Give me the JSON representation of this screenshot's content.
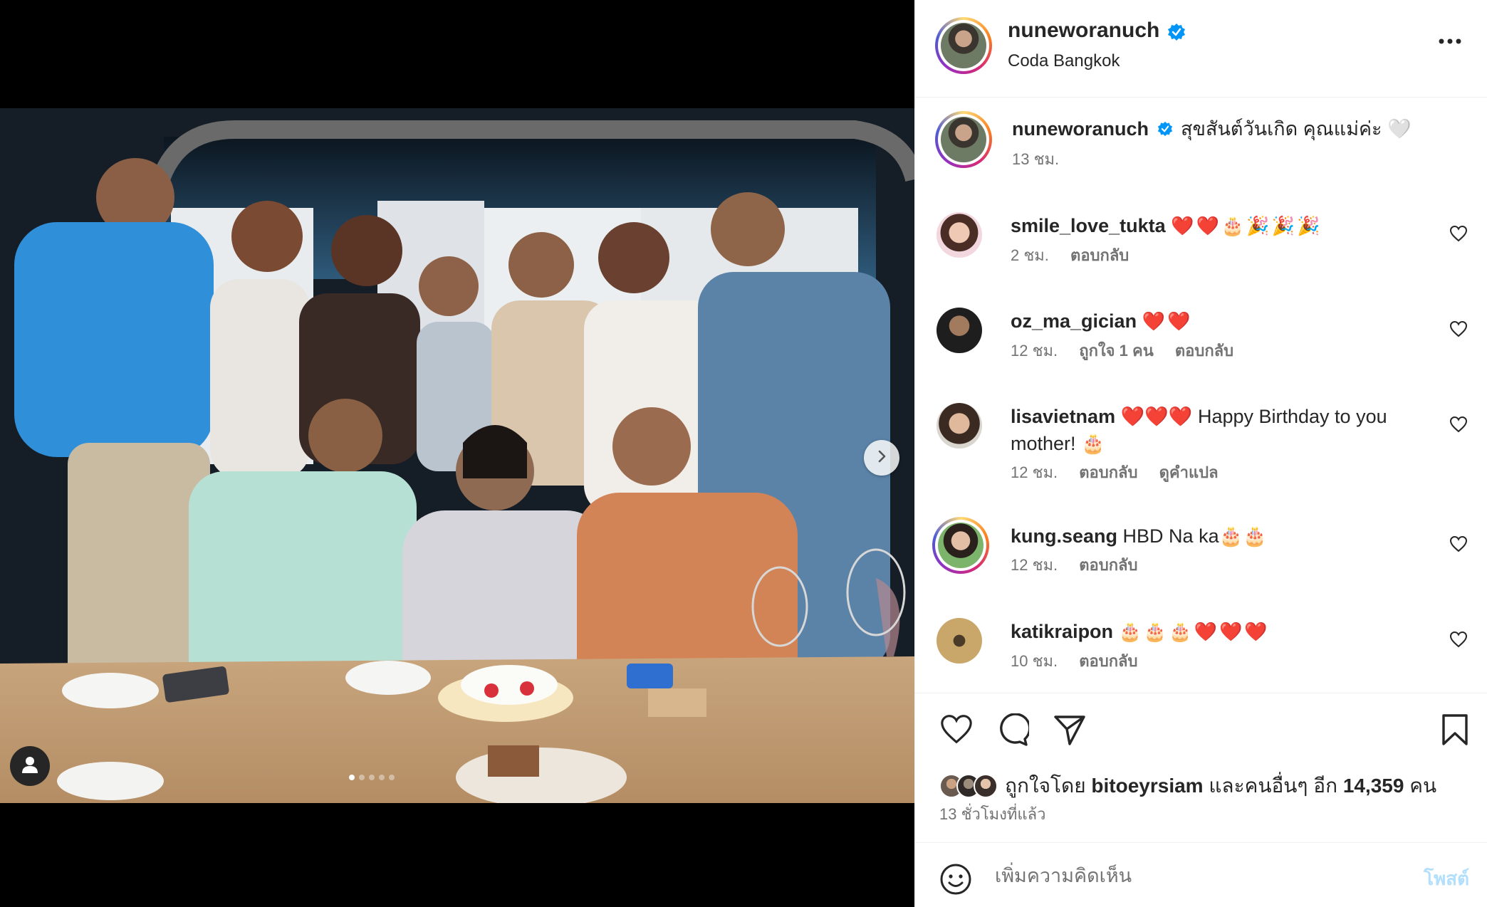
{
  "post": {
    "author": "nuneworanuch",
    "location": "Coda Bangkok",
    "caption": "สุขสันต์วันเกิด คุณแม่ค่ะ 🤍",
    "caption_time": "13 ชม."
  },
  "comments": [
    {
      "user": "smile_love_tukta",
      "text": "❤️❤️🎂🎉🎉🎉",
      "time": "2 ชม.",
      "likes": "",
      "reply": "ตอบกลับ",
      "translate": ""
    },
    {
      "user": "oz_ma_gician",
      "text": "❤️❤️",
      "time": "12 ชม.",
      "likes": "ถูกใจ 1 คน",
      "reply": "ตอบกลับ",
      "translate": ""
    },
    {
      "user": "lisavietnam",
      "text": "❤️❤️❤️ Happy Birthday to you mother! 🎂",
      "time": "12 ชม.",
      "likes": "",
      "reply": "ตอบกลับ",
      "translate": "ดูคำแปล"
    },
    {
      "user": "kung.seang",
      "text": "HBD Na ka🎂🎂",
      "time": "12 ชม.",
      "likes": "",
      "reply": "ตอบกลับ",
      "translate": ""
    },
    {
      "user": "katikraipon",
      "text": "🎂🎂🎂❤️❤️❤️",
      "time": "10 ชม.",
      "likes": "",
      "reply": "ตอบกลับ",
      "translate": ""
    }
  ],
  "likes": {
    "prefix": "ถูกใจโดย",
    "user": "bitoeyrsiam",
    "middle": "และคนอื่นๆ อีก",
    "count": "14,359",
    "suffix": "คน"
  },
  "timestamp": "13 ชั่วโมงที่แล้ว",
  "composer": {
    "placeholder": "เพิ่มความคิดเห็น",
    "post_label": "โพสต์"
  },
  "icons": {
    "verified": "verified-badge-icon",
    "more": "more-options-icon",
    "like": "heart-icon",
    "comment": "comment-bubble-icon",
    "share": "paper-plane-icon",
    "save": "bookmark-icon",
    "emoji": "smiley-icon",
    "next": "chevron-right-icon",
    "tag": "user-tag-icon"
  },
  "colors": {
    "verified": "#0095f6",
    "muted": "#737373",
    "post_disabled": "#b2dffc"
  }
}
